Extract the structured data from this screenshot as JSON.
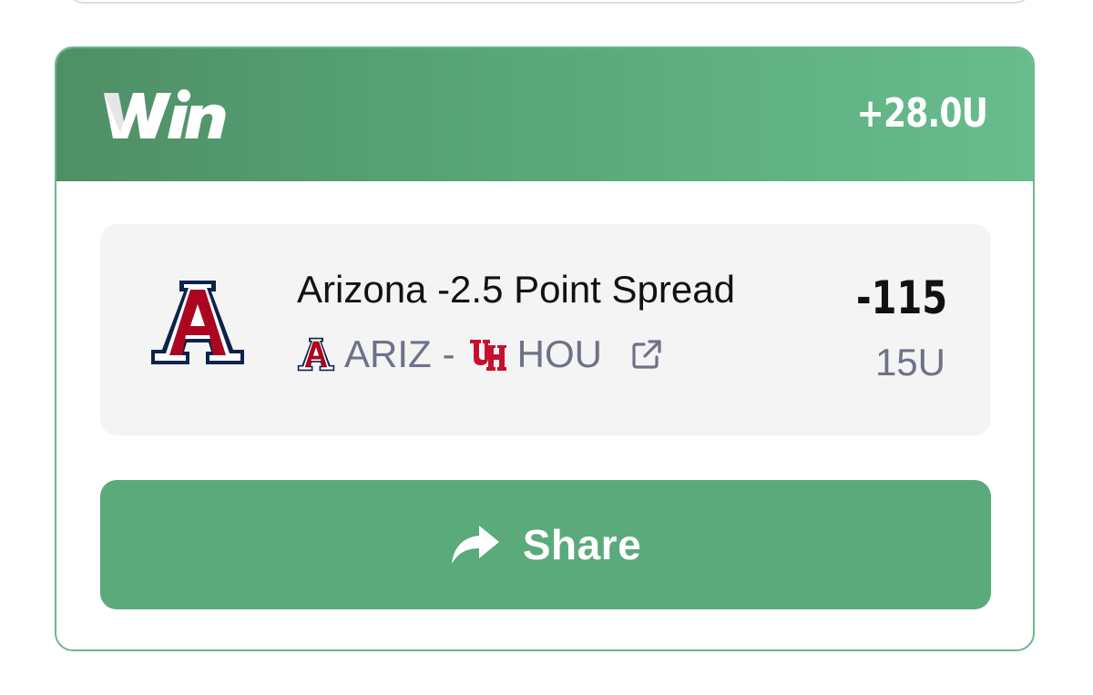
{
  "header": {
    "brand": "Win",
    "units_total": "+28.0U"
  },
  "bet": {
    "title": "Arizona -2.5 Point Spread",
    "team_home": "ARIZ",
    "separator": "-",
    "team_away": "HOU",
    "odds": "-115",
    "stake": "15U"
  },
  "share": {
    "label": "Share"
  },
  "icons": {
    "team_logo": "arizona-block-a-icon",
    "away_logo": "houston-uh-icon",
    "link": "external-link-icon",
    "share": "share-arrow-icon"
  },
  "colors": {
    "win_green": "#5aaa7c",
    "arizona_navy": "#0c234b",
    "arizona_red": "#ab0520",
    "houston_red": "#c8102e",
    "muted_text": "#6e7288"
  }
}
